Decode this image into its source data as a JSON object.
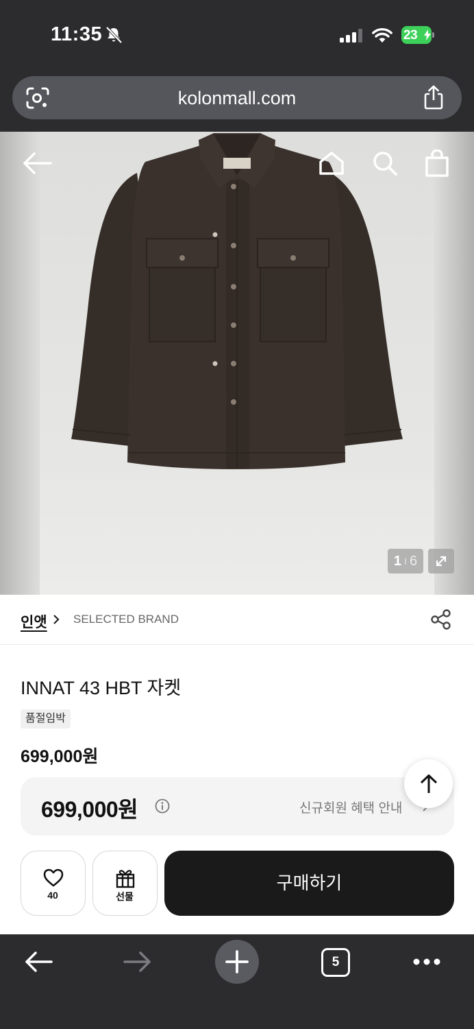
{
  "status_bar": {
    "time": "11:35",
    "battery": "23",
    "icons": [
      "bell-slash-icon",
      "cellular-signal-icon",
      "wifi-icon",
      "battery-charging-icon"
    ]
  },
  "browser": {
    "url": "kolonmall.com",
    "icons": [
      "lens-icon",
      "share-icon"
    ]
  },
  "gallery": {
    "current": "1",
    "separator": "I",
    "total": "6",
    "nav_icons": [
      "back-arrow-icon",
      "home-icon",
      "search-icon",
      "bag-icon",
      "expand-icon"
    ]
  },
  "product": {
    "brand": "인앳",
    "category": "SELECTED BRAND",
    "title": "INNAT 43 HBT 자켓",
    "badge": "품절임박",
    "price": "699,000원",
    "price_box": {
      "price": "699,000원",
      "benefit": "신규회원 혜택 안내"
    }
  },
  "actions": {
    "wish_count": "40",
    "gift_label": "선물",
    "buy_label": "구매하기"
  },
  "toolbar": {
    "tab_count": "5",
    "icons": [
      "back-icon",
      "forward-icon",
      "plus-icon",
      "tabs-icon",
      "more-icon"
    ]
  },
  "colors": {
    "chrome_bg": "#2c2c2e",
    "url_bar": "#55565b",
    "battery_green": "#3dd15a",
    "buy_button": "#1a1a1a",
    "price_box_bg": "#f4f4f4",
    "jacket_brown": "#3a312c"
  }
}
